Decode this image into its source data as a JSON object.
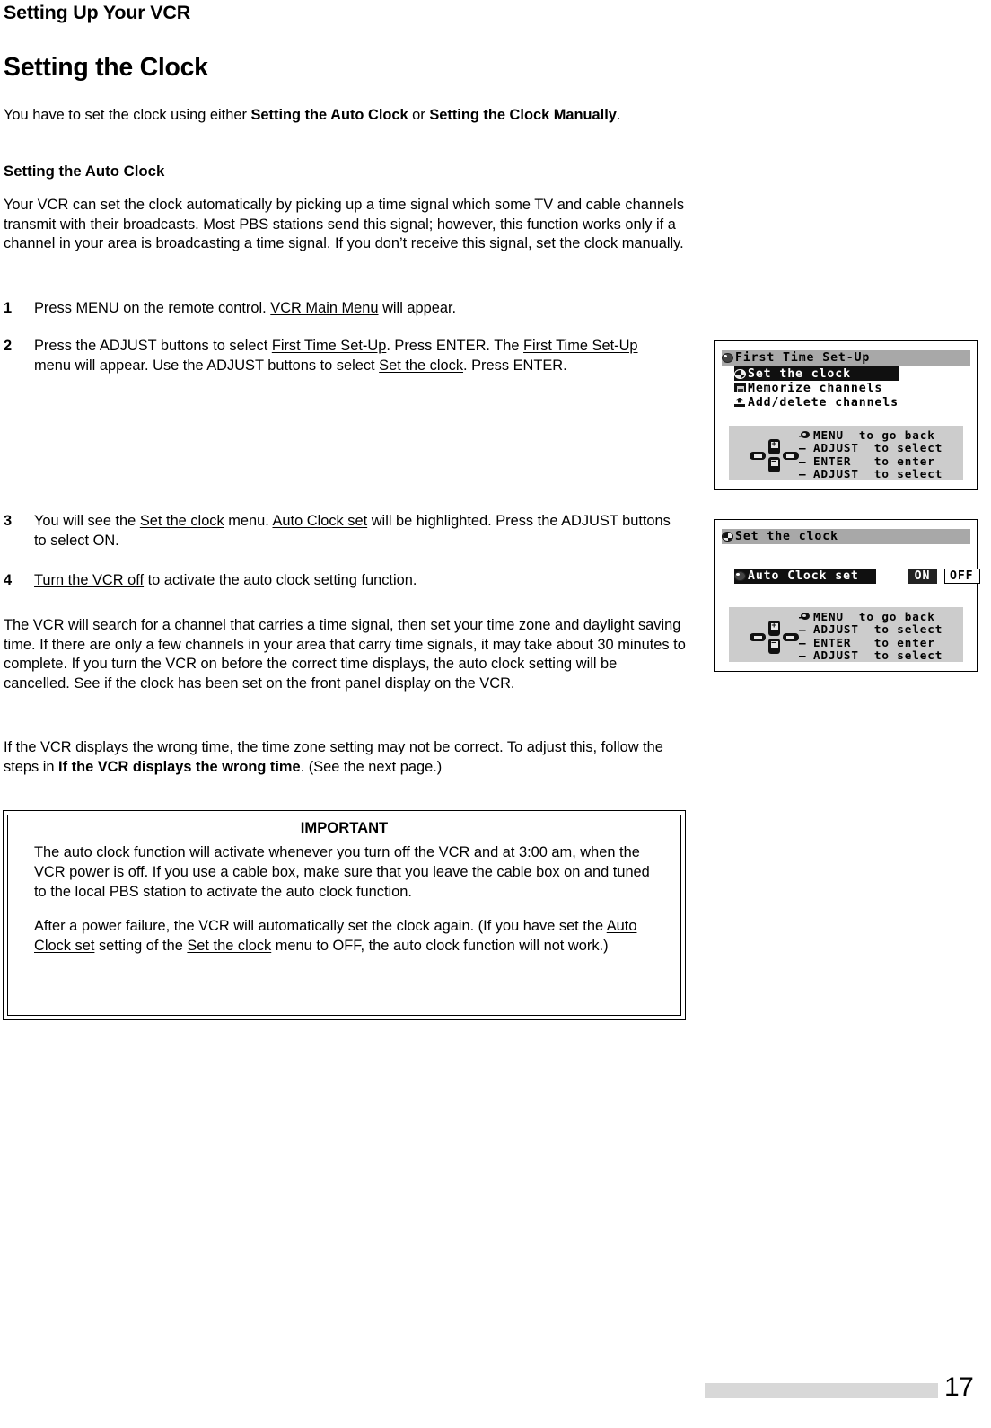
{
  "running_head": "Setting Up Your VCR",
  "section_title": "Setting the Clock",
  "intro": {
    "lead_1": "You have to set the clock using either ",
    "bold_1": "Setting the Auto Clock",
    "lead_2": " or ",
    "bold_2": "Setting the Clock Manually",
    "lead_3": "."
  },
  "subsection_title": "Setting the Auto Clock",
  "paragraphs": {
    "auto_clock_intro": "Your VCR can set the clock automatically by picking up a time signal which some TV and cable channels transmit with their broadcasts.  Most PBS stations send this signal; however, this function works only if a channel in your area is broadcasting a time signal.  If you don’t receive this signal, set the clock manually.",
    "search_info": "The VCR will search for a channel that carries a time signal, then set your time zone and daylight saving time.  If there are only a few channels in your area that carry time signals, it may take about 30 minutes to complete.  If you turn the VCR on before the correct time displays, the auto clock setting will be cancelled.  See if the clock has been set on the front panel display on the VCR.",
    "wrong_time_a": "If the VCR displays the wrong time, the time zone setting may not be correct.  To adjust this, follow the steps in ",
    "wrong_time_bold": "If the VCR displays the wrong time",
    "wrong_time_b": ".  (See the next page.)"
  },
  "steps": [
    {
      "num": "1",
      "parts": [
        {
          "t": "Press MENU on the remote control.  ",
          "s": "plain"
        },
        {
          "t": "VCR Main Menu",
          "s": "underline"
        },
        {
          "t": " will appear.",
          "s": "plain"
        }
      ]
    },
    {
      "num": "2",
      "parts": [
        {
          "t": "Press the ADJUST buttons to select ",
          "s": "plain"
        },
        {
          "t": "First Time Set-Up",
          "s": "underline"
        },
        {
          "t": ".  Press ENTER.  The ",
          "s": "plain"
        },
        {
          "t": "First Time Set-Up",
          "s": "underline"
        },
        {
          "t": " menu will appear.  Use the ADJUST buttons to select ",
          "s": "plain"
        },
        {
          "t": "Set the clock",
          "s": "underline"
        },
        {
          "t": ".  Press ENTER.",
          "s": "plain"
        }
      ]
    },
    {
      "num": "3",
      "parts": [
        {
          "t": "You will see the ",
          "s": "plain"
        },
        {
          "t": "Set the clock",
          "s": "underline"
        },
        {
          "t": " menu.  ",
          "s": "plain"
        },
        {
          "t": "Auto Clock set",
          "s": "underline"
        },
        {
          "t": " will be highlighted.  Press the ADJUST buttons to select ON.",
          "s": "plain"
        }
      ]
    },
    {
      "num": "4",
      "parts": [
        {
          "t": "Turn the VCR off",
          "s": "underline"
        },
        {
          "t": " to activate the auto clock setting function.",
          "s": "plain"
        }
      ]
    }
  ],
  "important_box": {
    "title": "IMPORTANT",
    "para_1": "The auto clock function will activate whenever you turn off the VCR and at 3:00 am, when the VCR power is off.  If you use a cable box, make sure that you leave the cable box on and tuned to the local PBS station to activate the auto clock function.",
    "para_2_parts": [
      {
        "t": "After a power failure, the VCR will automatically set the clock again.  (If you have set the ",
        "s": "plain"
      },
      {
        "t": "Auto Clock set",
        "s": "underline"
      },
      {
        "t": " setting of the ",
        "s": "plain"
      },
      {
        "t": "Set the clock",
        "s": "underline"
      },
      {
        "t": " menu to OFF, the auto clock function will not work.)",
        "s": "plain"
      }
    ]
  },
  "osd_screens": [
    {
      "id": "first-time-setup",
      "title": "First Time Set-Up",
      "title_icon": "disc-icon",
      "items": [
        {
          "label": "Set the clock",
          "icon": "clock-icon",
          "selected": true
        },
        {
          "label": "Memorize channels",
          "icon": "tv-icon",
          "selected": false
        },
        {
          "label": "Add/delete channels",
          "icon": "add-delete-icon",
          "selected": false
        }
      ],
      "help": [
        {
          "icon": "menu-dot-icon",
          "dash": "—",
          "text": "MENU  to go back"
        },
        {
          "icon": "",
          "dash": "—",
          "text": "ADJUST  to select"
        },
        {
          "icon": "",
          "dash": "—",
          "text": "ENTER   to enter"
        },
        {
          "icon": "",
          "dash": "—",
          "text": "ADJUST  to select"
        }
      ]
    },
    {
      "id": "set-the-clock",
      "title": "Set the clock",
      "title_icon": "clock-icon",
      "option": {
        "label": "Auto Clock set",
        "icon": "disc-icon",
        "values": [
          {
            "label": "ON",
            "state": "selected"
          },
          {
            "label": "OFF",
            "state": "outlined"
          }
        ]
      },
      "help": [
        {
          "icon": "menu-dot-icon",
          "dash": "—",
          "text": "MENU  to go back"
        },
        {
          "icon": "",
          "dash": "—",
          "text": "ADJUST  to select"
        },
        {
          "icon": "",
          "dash": "—",
          "text": "ENTER   to enter"
        },
        {
          "icon": "",
          "dash": "—",
          "text": "ADJUST  to select"
        }
      ]
    }
  ],
  "footer": {
    "page_number": "17"
  },
  "colors": {
    "osd_titlebar_gray": "#a8a8a8",
    "osd_help_gray": "#cccccc",
    "osd_highlight_black": "#101010",
    "footer_bar_gray": "#d8d8d8"
  }
}
